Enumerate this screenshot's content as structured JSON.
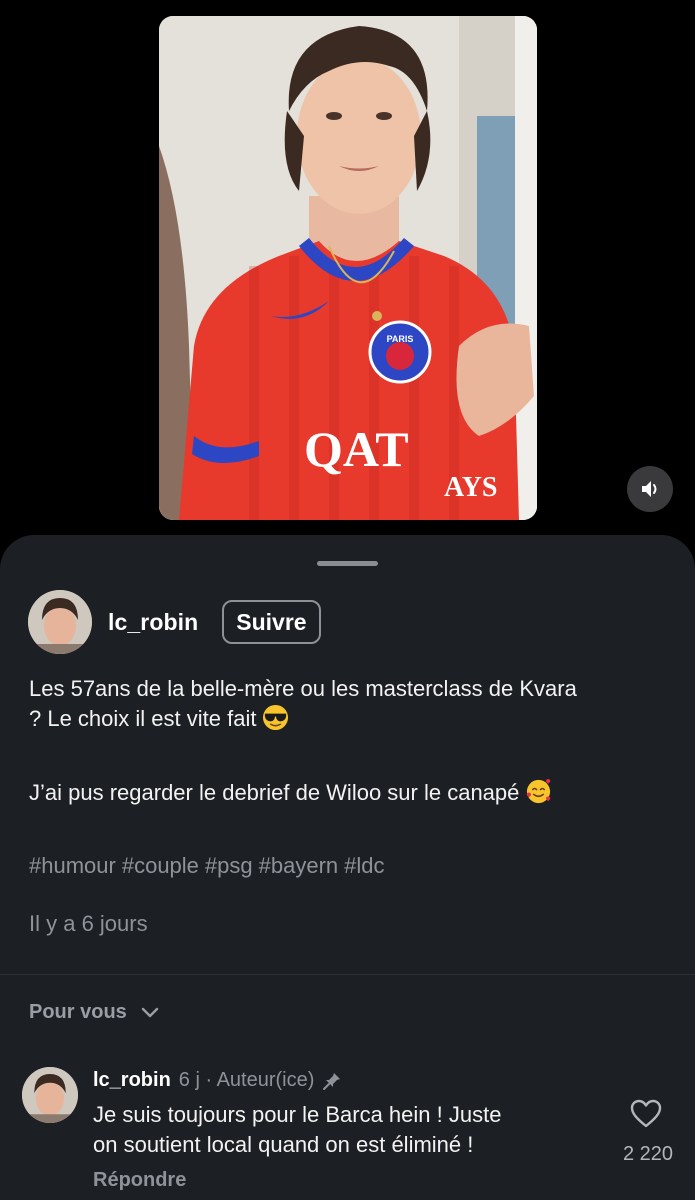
{
  "video": {
    "jersey_text_1": "QAT",
    "jersey_text_2": "AYS",
    "badge_text": "PARIS"
  },
  "post": {
    "username": "lc_robin",
    "follow_label": "Suivre",
    "caption_line1": "Les 57ans de la belle-mère ou les masterclass de Kvara",
    "caption_line2": "? Le choix il est vite fait",
    "caption_para2": "J’ai pus regarder le debrief de Wiloo sur le canapé",
    "emoji1": "sunglasses-face-emoji",
    "emoji2": "smiling-face-with-hearts-emoji",
    "hashtags": [
      "#humour",
      "#couple",
      "#psg",
      "#bayern",
      "#ldc"
    ],
    "timestamp": "Il y a 6 jours"
  },
  "comments_section": {
    "sort_label": "Pour vous"
  },
  "comment": {
    "username": "lc_robin",
    "meta": "6 j · Auteur(ice)",
    "text_line1": "Je suis toujours pour le Barca hein ! Juste",
    "text_line2": "on soutient local quand on est éliminé !",
    "reply_label": "Répondre",
    "like_count": "2 220"
  },
  "colors": {
    "background": "#000000",
    "sheet": "#1c1f24",
    "secondary_text": "#8f9399",
    "jersey_red": "#e8392d",
    "jersey_blue": "#2c46c4"
  }
}
